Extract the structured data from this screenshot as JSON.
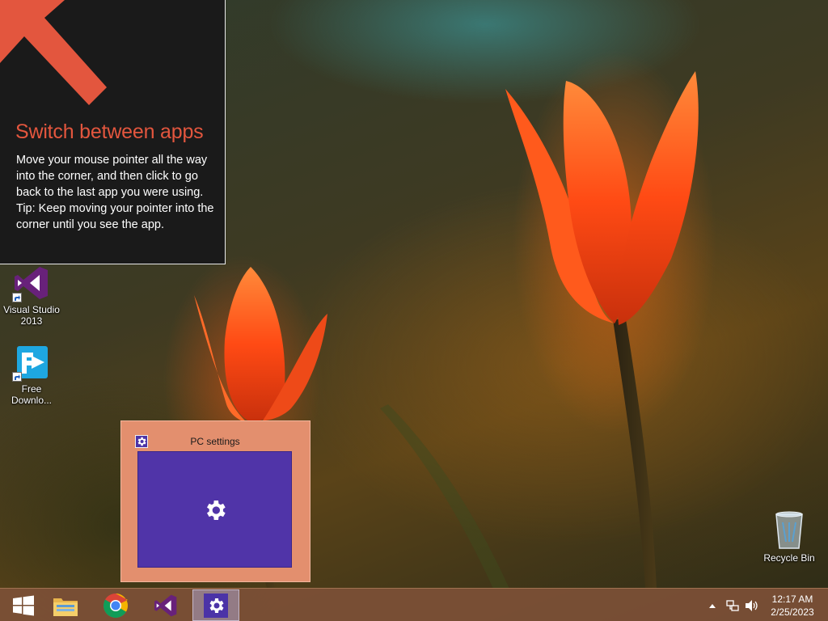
{
  "hint": {
    "title": "Switch between apps",
    "body": [
      "Move your mouse pointer all the way into the corner, and then click to go back to the last app you were using.",
      "Tip: Keep moving your pointer into the corner until you see the app."
    ],
    "accent": "#e3563e"
  },
  "desktop": {
    "icons": [
      {
        "label": "Visual Studio 2013",
        "icon": "visual-studio-icon"
      },
      {
        "label": "Free Downlo...",
        "icon": "free-download-manager-icon"
      }
    ],
    "recycle_bin": {
      "label": "Recycle Bin",
      "icon": "recycle-bin-icon"
    }
  },
  "preview": {
    "title": "PC settings",
    "icon": "gear-icon",
    "window_color": "#5034a8",
    "background_color": "#e38f6e"
  },
  "taskbar": {
    "buttons": [
      {
        "name": "start-button",
        "icon": "windows-logo-icon"
      },
      {
        "name": "file-explorer",
        "icon": "folder-icon"
      },
      {
        "name": "google-chrome",
        "icon": "chrome-icon"
      },
      {
        "name": "visual-studio",
        "icon": "visual-studio-icon"
      },
      {
        "name": "pc-settings",
        "icon": "gear-icon",
        "active": true
      }
    ],
    "tray": {
      "icons": [
        "show-hidden-icons-chevron",
        "network-icon",
        "volume-icon"
      ]
    },
    "clock": {
      "time": "12:17 AM",
      "date": "2/25/2023"
    }
  }
}
